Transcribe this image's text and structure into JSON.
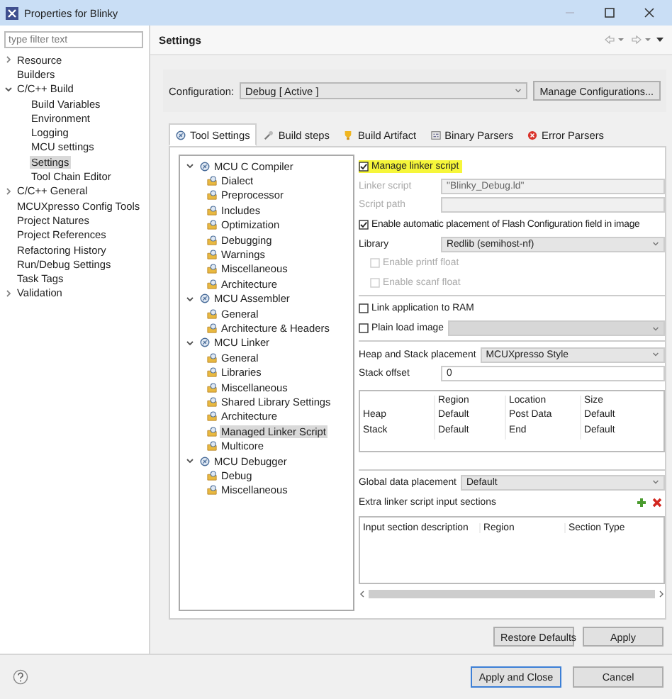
{
  "window": {
    "title": "Properties for Blinky"
  },
  "nav": {
    "filter": {
      "placeholder": "type filter text"
    },
    "items": [
      {
        "label": "Resource",
        "expanded": false,
        "selected": false
      },
      {
        "label": "Builders",
        "selected": false
      },
      {
        "label": "C/C++ Build",
        "expanded": true,
        "selected": false,
        "children": [
          {
            "label": "Build Variables",
            "selected": false
          },
          {
            "label": "Environment",
            "selected": false
          },
          {
            "label": "Logging",
            "selected": false
          },
          {
            "label": "MCU settings",
            "selected": false
          },
          {
            "label": "Settings",
            "selected": true
          },
          {
            "label": "Tool Chain Editor",
            "selected": false
          }
        ]
      },
      {
        "label": "C/C++ General",
        "expanded": false,
        "selected": false
      },
      {
        "label": "MCUXpresso Config Tools",
        "selected": false
      },
      {
        "label": "Project Natures",
        "selected": false
      },
      {
        "label": "Project References",
        "selected": false
      },
      {
        "label": "Refactoring History",
        "selected": false
      },
      {
        "label": "Run/Debug Settings",
        "selected": false
      },
      {
        "label": "Task Tags",
        "selected": false
      },
      {
        "label": "Validation",
        "expanded": false,
        "selected": false
      }
    ]
  },
  "page": {
    "title": "Settings",
    "configuration": {
      "label": "Configuration:",
      "value": "Debug  [ Active ]",
      "button": "Manage Configurations..."
    },
    "tabs": [
      {
        "label": "Tool Settings",
        "kind": "tool",
        "selected": true
      },
      {
        "label": "Build steps",
        "kind": "wrench",
        "selected": false
      },
      {
        "label": "Build Artifact",
        "kind": "artifact",
        "selected": false
      },
      {
        "label": "Binary Parsers",
        "kind": "binary",
        "selected": false
      },
      {
        "label": "Error Parsers",
        "kind": "error",
        "selected": false
      }
    ],
    "tool_tree": [
      {
        "label": "MCU C Compiler",
        "expanded": true,
        "selected": false,
        "children": [
          {
            "label": "Dialect",
            "selected": false
          },
          {
            "label": "Preprocessor",
            "selected": false
          },
          {
            "label": "Includes",
            "selected": false
          },
          {
            "label": "Optimization",
            "selected": false
          },
          {
            "label": "Debugging",
            "selected": false
          },
          {
            "label": "Warnings",
            "selected": false
          },
          {
            "label": "Miscellaneous",
            "selected": false
          },
          {
            "label": "Architecture",
            "selected": false
          }
        ]
      },
      {
        "label": "MCU Assembler",
        "expanded": true,
        "selected": false,
        "children": [
          {
            "label": "General",
            "selected": false
          },
          {
            "label": "Architecture & Headers",
            "selected": false
          }
        ]
      },
      {
        "label": "MCU Linker",
        "expanded": true,
        "selected": false,
        "children": [
          {
            "label": "General",
            "selected": false
          },
          {
            "label": "Libraries",
            "selected": false
          },
          {
            "label": "Miscellaneous",
            "selected": false
          },
          {
            "label": "Shared Library Settings",
            "selected": false
          },
          {
            "label": "Architecture",
            "selected": false
          },
          {
            "label": "Managed Linker Script",
            "selected": true
          },
          {
            "label": "Multicore",
            "selected": false
          }
        ]
      },
      {
        "label": "MCU Debugger",
        "expanded": true,
        "selected": false,
        "children": [
          {
            "label": "Debug",
            "selected": false
          },
          {
            "label": "Miscellaneous",
            "selected": false
          }
        ]
      }
    ],
    "linker": {
      "manage_linker_script": {
        "label": "Manage linker script",
        "checked": true,
        "highlighted": true
      },
      "linker_script": {
        "label": "Linker script",
        "value": "\"Blinky_Debug.ld\"",
        "disabled": true
      },
      "script_path": {
        "label": "Script path",
        "disabled": true
      },
      "auto_flash_config": {
        "label": "Enable automatic placement of Flash Configuration field in image",
        "checked": true
      },
      "library": {
        "label": "Library",
        "value": "Redlib (semihost-nf)"
      },
      "printf_float": {
        "label": "Enable printf float",
        "checked": false,
        "disabled": true
      },
      "scanf_float": {
        "label": "Enable scanf float",
        "checked": false,
        "disabled": true
      },
      "link_to_ram": {
        "label": "Link application to RAM",
        "checked": false
      },
      "plain_load_image": {
        "label": "Plain load image",
        "checked": false
      },
      "heap_stack_placement": {
        "label": "Heap and Stack placement",
        "value": "MCUXpresso Style"
      },
      "stack_offset": {
        "label": "Stack offset",
        "value": "0"
      },
      "heap_stack_table": {
        "columns": [
          "Region",
          "Location",
          "Size"
        ],
        "rows": [
          {
            "name": "Heap",
            "cells": [
              "Default",
              "Post Data",
              "Default"
            ]
          },
          {
            "name": "Stack",
            "cells": [
              "Default",
              "End",
              "Default"
            ]
          }
        ]
      },
      "global_data_placement": {
        "label": "Global data placement",
        "value": "Default"
      },
      "extra_sections": {
        "label": "Extra linker script input sections",
        "columns": [
          "Input section description",
          "Region",
          "Section Type"
        ]
      }
    },
    "page_buttons": [
      "Restore Defaults",
      "Apply"
    ]
  },
  "footer_buttons": [
    {
      "label": "Apply and Close",
      "selected": true
    },
    {
      "label": "Cancel",
      "selected": false
    }
  ]
}
